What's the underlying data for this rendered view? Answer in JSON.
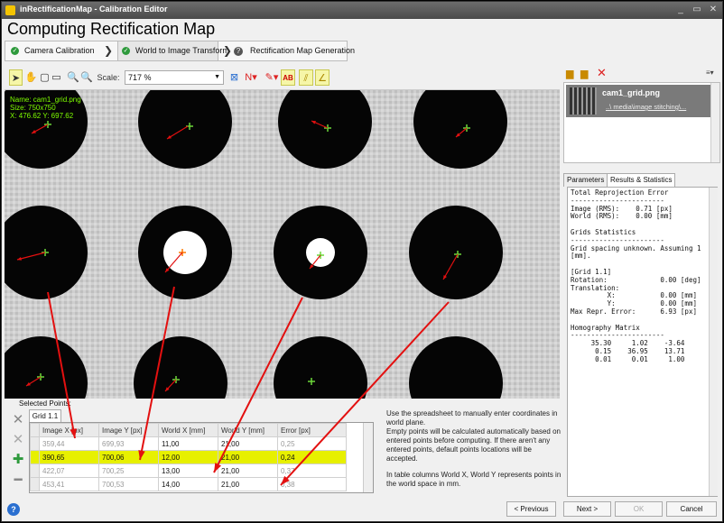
{
  "window": {
    "title": "inRectificationMap - Calibration Editor",
    "minimize": "_",
    "maximize": "▭",
    "close": "✕"
  },
  "heading": "Computing Rectification Map",
  "tabs": [
    {
      "label": "Camera Calibration",
      "state": "done"
    },
    {
      "label": "World to Image Transform",
      "state": "done"
    },
    {
      "label": "Rectification Map Generation",
      "state": "help"
    }
  ],
  "toolbar": {
    "scale_label": "Scale:",
    "scale_value": "717 %",
    "ab_label": "AB"
  },
  "viewer": {
    "info": {
      "name": "Name: cam1_grid.png",
      "size": "Size: 750x750",
      "coords": "X: 476.62 Y: 697.62"
    }
  },
  "selected_points": {
    "label": "Selected Points:",
    "grid_tab": "Grid 1.1",
    "columns": [
      "Image X [px]",
      "Image Y [px]",
      "World X [mm]",
      "World Y [mm]",
      "Error [px]"
    ],
    "rows": [
      {
        "cells": [
          "359,44",
          "699,93",
          "11,00",
          "21,00",
          "0,25"
        ],
        "highlight": false
      },
      {
        "cells": [
          "390,65",
          "700,06",
          "12,00",
          "21,00",
          "0,24"
        ],
        "highlight": true
      },
      {
        "cells": [
          "422,07",
          "700,25",
          "13,00",
          "21,00",
          "0,37"
        ],
        "highlight": false
      },
      {
        "cells": [
          "453,41",
          "700,53",
          "14,00",
          "21,00",
          "0,38"
        ],
        "highlight": false
      }
    ]
  },
  "help_text": {
    "p1": "Use the spreadsheet to manually enter coordinates in world plane.",
    "p2": "Empty points will be calculated automatically based on entered points before computing. If there aren't any entered points, default points locations will be accepted.",
    "p3": "In table columns World X, World Y represents points in the world space in mm."
  },
  "right_panel": {
    "file_name": "cam1_grid.png",
    "file_path": "..\\ media\\image stitching\\...",
    "tabs": [
      "Parameters",
      "Results & Statistics"
    ],
    "results_text": "Total Reprojection Error\n-----------------------\nImage (RMS):    0.71 [px]\nWorld (RMS):    0.00 [mm]\n\nGrids Statistics\n-----------------------\nGrid spacing unknown. Assuming 1\n[mm].\n\n[Grid 1.1]\nRotation:             0.00 [deg]\nTranslation:\n         X:           0.00 [mm]\n         Y:           0.00 [mm]\nMax Repr. Error:      6.93 [px]\n\nHomography Matrix\n-----------------------\n     35.30     1.02    -3.64\n      0.15    36.95    13.71\n      0.01     0.01     1.00"
  },
  "buttons": {
    "previous": "< Previous",
    "next": "Next >",
    "ok": "OK",
    "cancel": "Cancel",
    "help": "?"
  },
  "colors": {
    "highlight": "#e7f000",
    "arrow": "#e31010",
    "marker": "#6cd83a",
    "marker_hot": "#ff7a00"
  }
}
